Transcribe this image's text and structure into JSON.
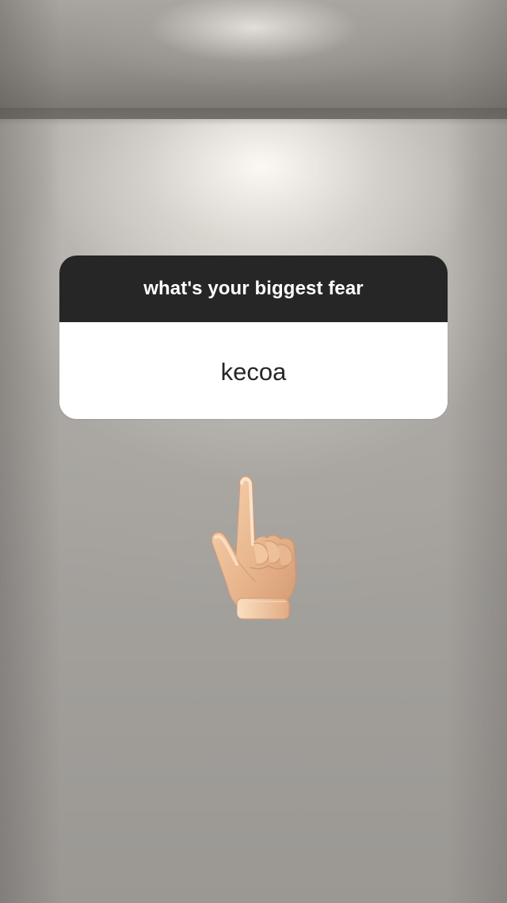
{
  "story": {
    "question_sticker": {
      "question": "what's your biggest fear",
      "answer": "kecoa"
    },
    "sticker": {
      "icon": "pointing-up-hand-icon",
      "skin_tone": "light-medium"
    }
  },
  "colors": {
    "header_background": "#262626",
    "header_text": "#ffffff",
    "answer_background": "#ffffff",
    "answer_text": "#262626",
    "wall": "#a4a19d"
  }
}
